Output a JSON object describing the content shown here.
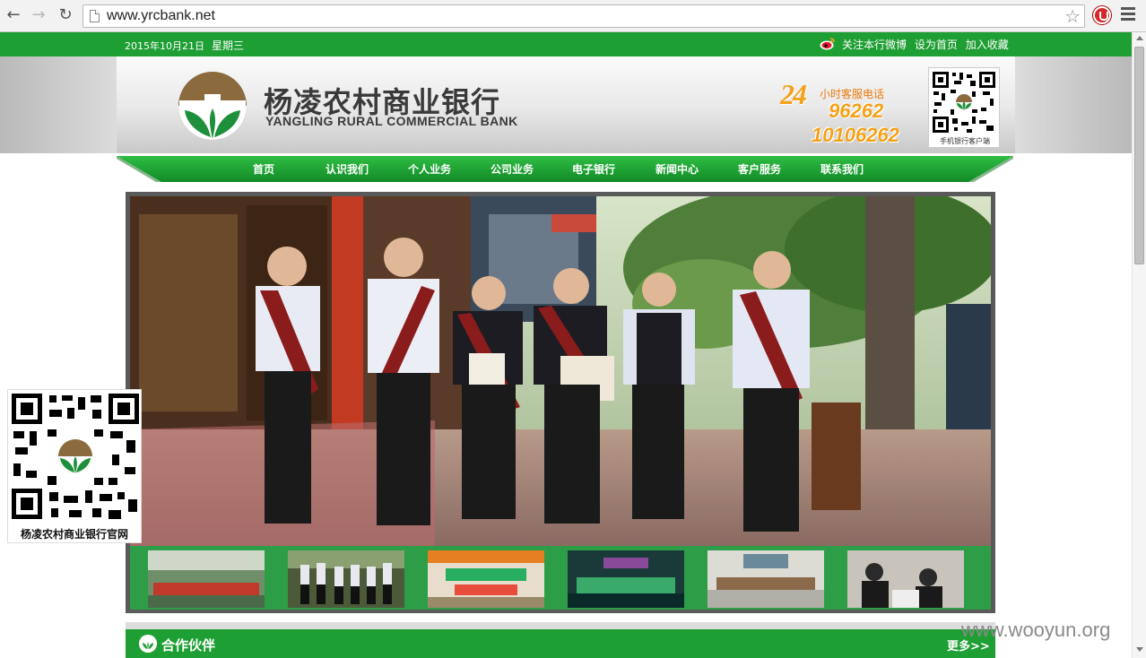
{
  "browser": {
    "url": "www.yrcbank.net"
  },
  "topbar": {
    "date": "2015年10月21日",
    "weekday": "星期三",
    "links": [
      "关注本行微博",
      "设为首页",
      "加入收藏"
    ]
  },
  "header": {
    "bank_name_cn": "杨凌农村商业银行",
    "bank_name_en": "YANGLING RURAL COMMERCIAL BANK",
    "hours": "24",
    "hotline_label": "小时客服电话",
    "phone_1": "96262",
    "phone_2": "10106262",
    "qr_caption": "手机银行客户端"
  },
  "nav": {
    "items": [
      "首页",
      "认识我们",
      "个人业务",
      "公司业务",
      "电子银行",
      "新闻中心",
      "客户服务",
      "联系我们"
    ]
  },
  "float_qr": {
    "caption": "杨凌农村商业银行官网"
  },
  "partners": {
    "title": "合作伙伴",
    "more": "更多>>"
  },
  "watermark": "www.wooyun.org",
  "colors": {
    "brand_green": "#1e9f33",
    "accent_orange": "#f4a21b",
    "logo_brown": "#8b6a3e"
  }
}
